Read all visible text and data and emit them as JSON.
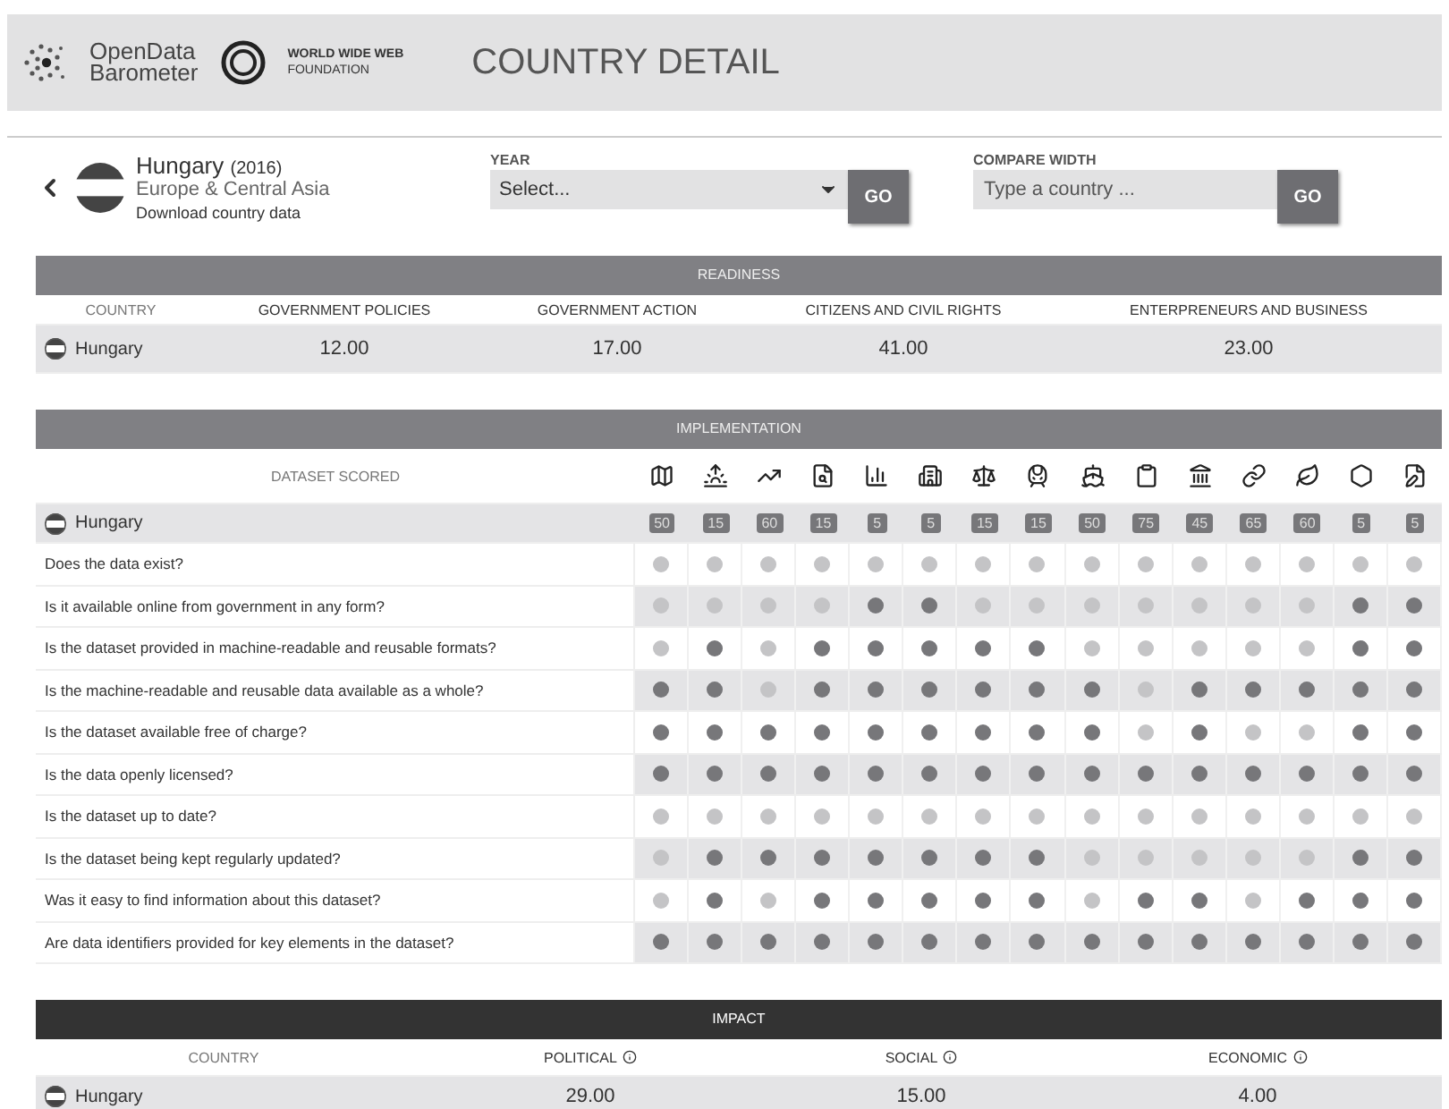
{
  "header": {
    "logo_line_1": "OpenData",
    "logo_line_2": "Barometer",
    "partner_line_1": "WORLD WIDE WEB",
    "partner_line_2": "FOUNDATION",
    "page_title": "COUNTRY DETAIL"
  },
  "country": {
    "name": "Hungary",
    "year": "(2016)",
    "region": "Europe & Central Asia",
    "download_link": "Download country data"
  },
  "year_filter": {
    "label": "YEAR",
    "value": "Select...",
    "button": "GO"
  },
  "compare": {
    "label": "COMPARE WIDTH",
    "placeholder": "Type a country ...",
    "button": "GO"
  },
  "readiness": {
    "title": "READINESS",
    "columns": [
      "COUNTRY",
      "GOVERNMENT POLICIES",
      "GOVERNMENT ACTION",
      "CITIZENS AND CIVIL RIGHTS",
      "ENTERPRENEURS AND BUSINESS"
    ],
    "rows": [
      {
        "country": "Hungary",
        "values": [
          "12.00",
          "17.00",
          "41.00",
          "23.00"
        ]
      }
    ]
  },
  "implementation": {
    "title": "IMPLEMENTATION",
    "first_column": "DATASET SCORED",
    "country": "Hungary",
    "scores": [
      "50",
      "15",
      "60",
      "15",
      "5",
      "5",
      "15",
      "15",
      "50",
      "75",
      "45",
      "65",
      "60",
      "5",
      "5"
    ],
    "questions": [
      {
        "text": "Does the data exist?",
        "answers": [
          false,
          false,
          false,
          false,
          false,
          false,
          false,
          false,
          false,
          false,
          false,
          false,
          false,
          false,
          false
        ]
      },
      {
        "text": "Is it available online from government in any form?",
        "answers": [
          false,
          false,
          false,
          false,
          true,
          true,
          false,
          false,
          false,
          false,
          false,
          false,
          false,
          true,
          true
        ]
      },
      {
        "text": "Is the dataset provided in machine-readable and reusable formats?",
        "answers": [
          false,
          true,
          false,
          true,
          true,
          true,
          true,
          true,
          false,
          false,
          false,
          false,
          false,
          true,
          true
        ]
      },
      {
        "text": "Is the machine-readable and reusable data available as a whole?",
        "answers": [
          true,
          true,
          false,
          true,
          true,
          true,
          true,
          true,
          true,
          false,
          true,
          true,
          true,
          true,
          true
        ]
      },
      {
        "text": "Is the dataset available free of charge?",
        "answers": [
          true,
          true,
          true,
          true,
          true,
          true,
          true,
          true,
          true,
          false,
          true,
          false,
          false,
          true,
          true
        ]
      },
      {
        "text": "Is the data openly licensed?",
        "answers": [
          true,
          true,
          true,
          true,
          true,
          true,
          true,
          true,
          true,
          true,
          true,
          true,
          true,
          true,
          true
        ]
      },
      {
        "text": "Is the dataset up to date?",
        "answers": [
          false,
          false,
          false,
          false,
          false,
          false,
          false,
          false,
          false,
          false,
          false,
          false,
          false,
          false,
          false
        ]
      },
      {
        "text": "Is the dataset being kept regularly updated?",
        "answers": [
          false,
          true,
          true,
          true,
          true,
          true,
          true,
          true,
          false,
          false,
          false,
          false,
          false,
          true,
          true
        ]
      },
      {
        "text": "Was it easy to find information about this dataset?",
        "answers": [
          false,
          true,
          false,
          true,
          true,
          true,
          true,
          true,
          false,
          true,
          true,
          false,
          true,
          true,
          true
        ]
      },
      {
        "text": "Are data identifiers provided for key elements in the dataset?",
        "answers": [
          true,
          true,
          true,
          true,
          true,
          true,
          true,
          true,
          true,
          true,
          true,
          true,
          true,
          true,
          true
        ]
      }
    ]
  },
  "impact": {
    "title": "IMPACT",
    "country_column": "COUNTRY",
    "metric_columns": [
      "POLITICAL",
      "SOCIAL",
      "ECONOMIC"
    ],
    "rows": [
      {
        "country": "Hungary",
        "values": [
          "29.00",
          "15.00",
          "4.00"
        ]
      }
    ]
  }
}
